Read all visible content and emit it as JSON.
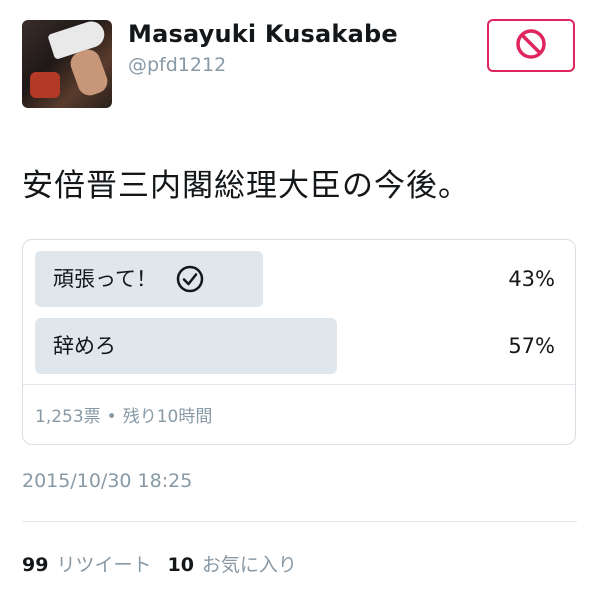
{
  "user": {
    "display_name": "Masayuki Kusakabe",
    "handle": "@pfd1212",
    "avatar": "profile-photo-megaphone"
  },
  "follow_button": {
    "icon": "block-icon",
    "color": "#e0245e"
  },
  "tweet": {
    "text": "安倍晋三内閣総理大臣の今後。"
  },
  "poll": {
    "options": [
      {
        "label": "頑張って！",
        "percent": "43%",
        "share": 0.43,
        "selected": true,
        "icon": "check-circle-icon"
      },
      {
        "label": "辞めろ",
        "percent": "57%",
        "share": 0.57,
        "selected": false
      }
    ],
    "votes": "1,253票",
    "separator": "•",
    "time_left": "残り10時間"
  },
  "timestamp": "2015/10/30 18:25",
  "stats": {
    "retweets_count": "99",
    "retweets_label": "リツイート",
    "likes_count": "10",
    "likes_label": "お気に入り"
  },
  "colors": {
    "accent": "#e0245e",
    "muted": "#8899a6",
    "bar": "#dfe6ec",
    "border": "#d8dee3"
  }
}
